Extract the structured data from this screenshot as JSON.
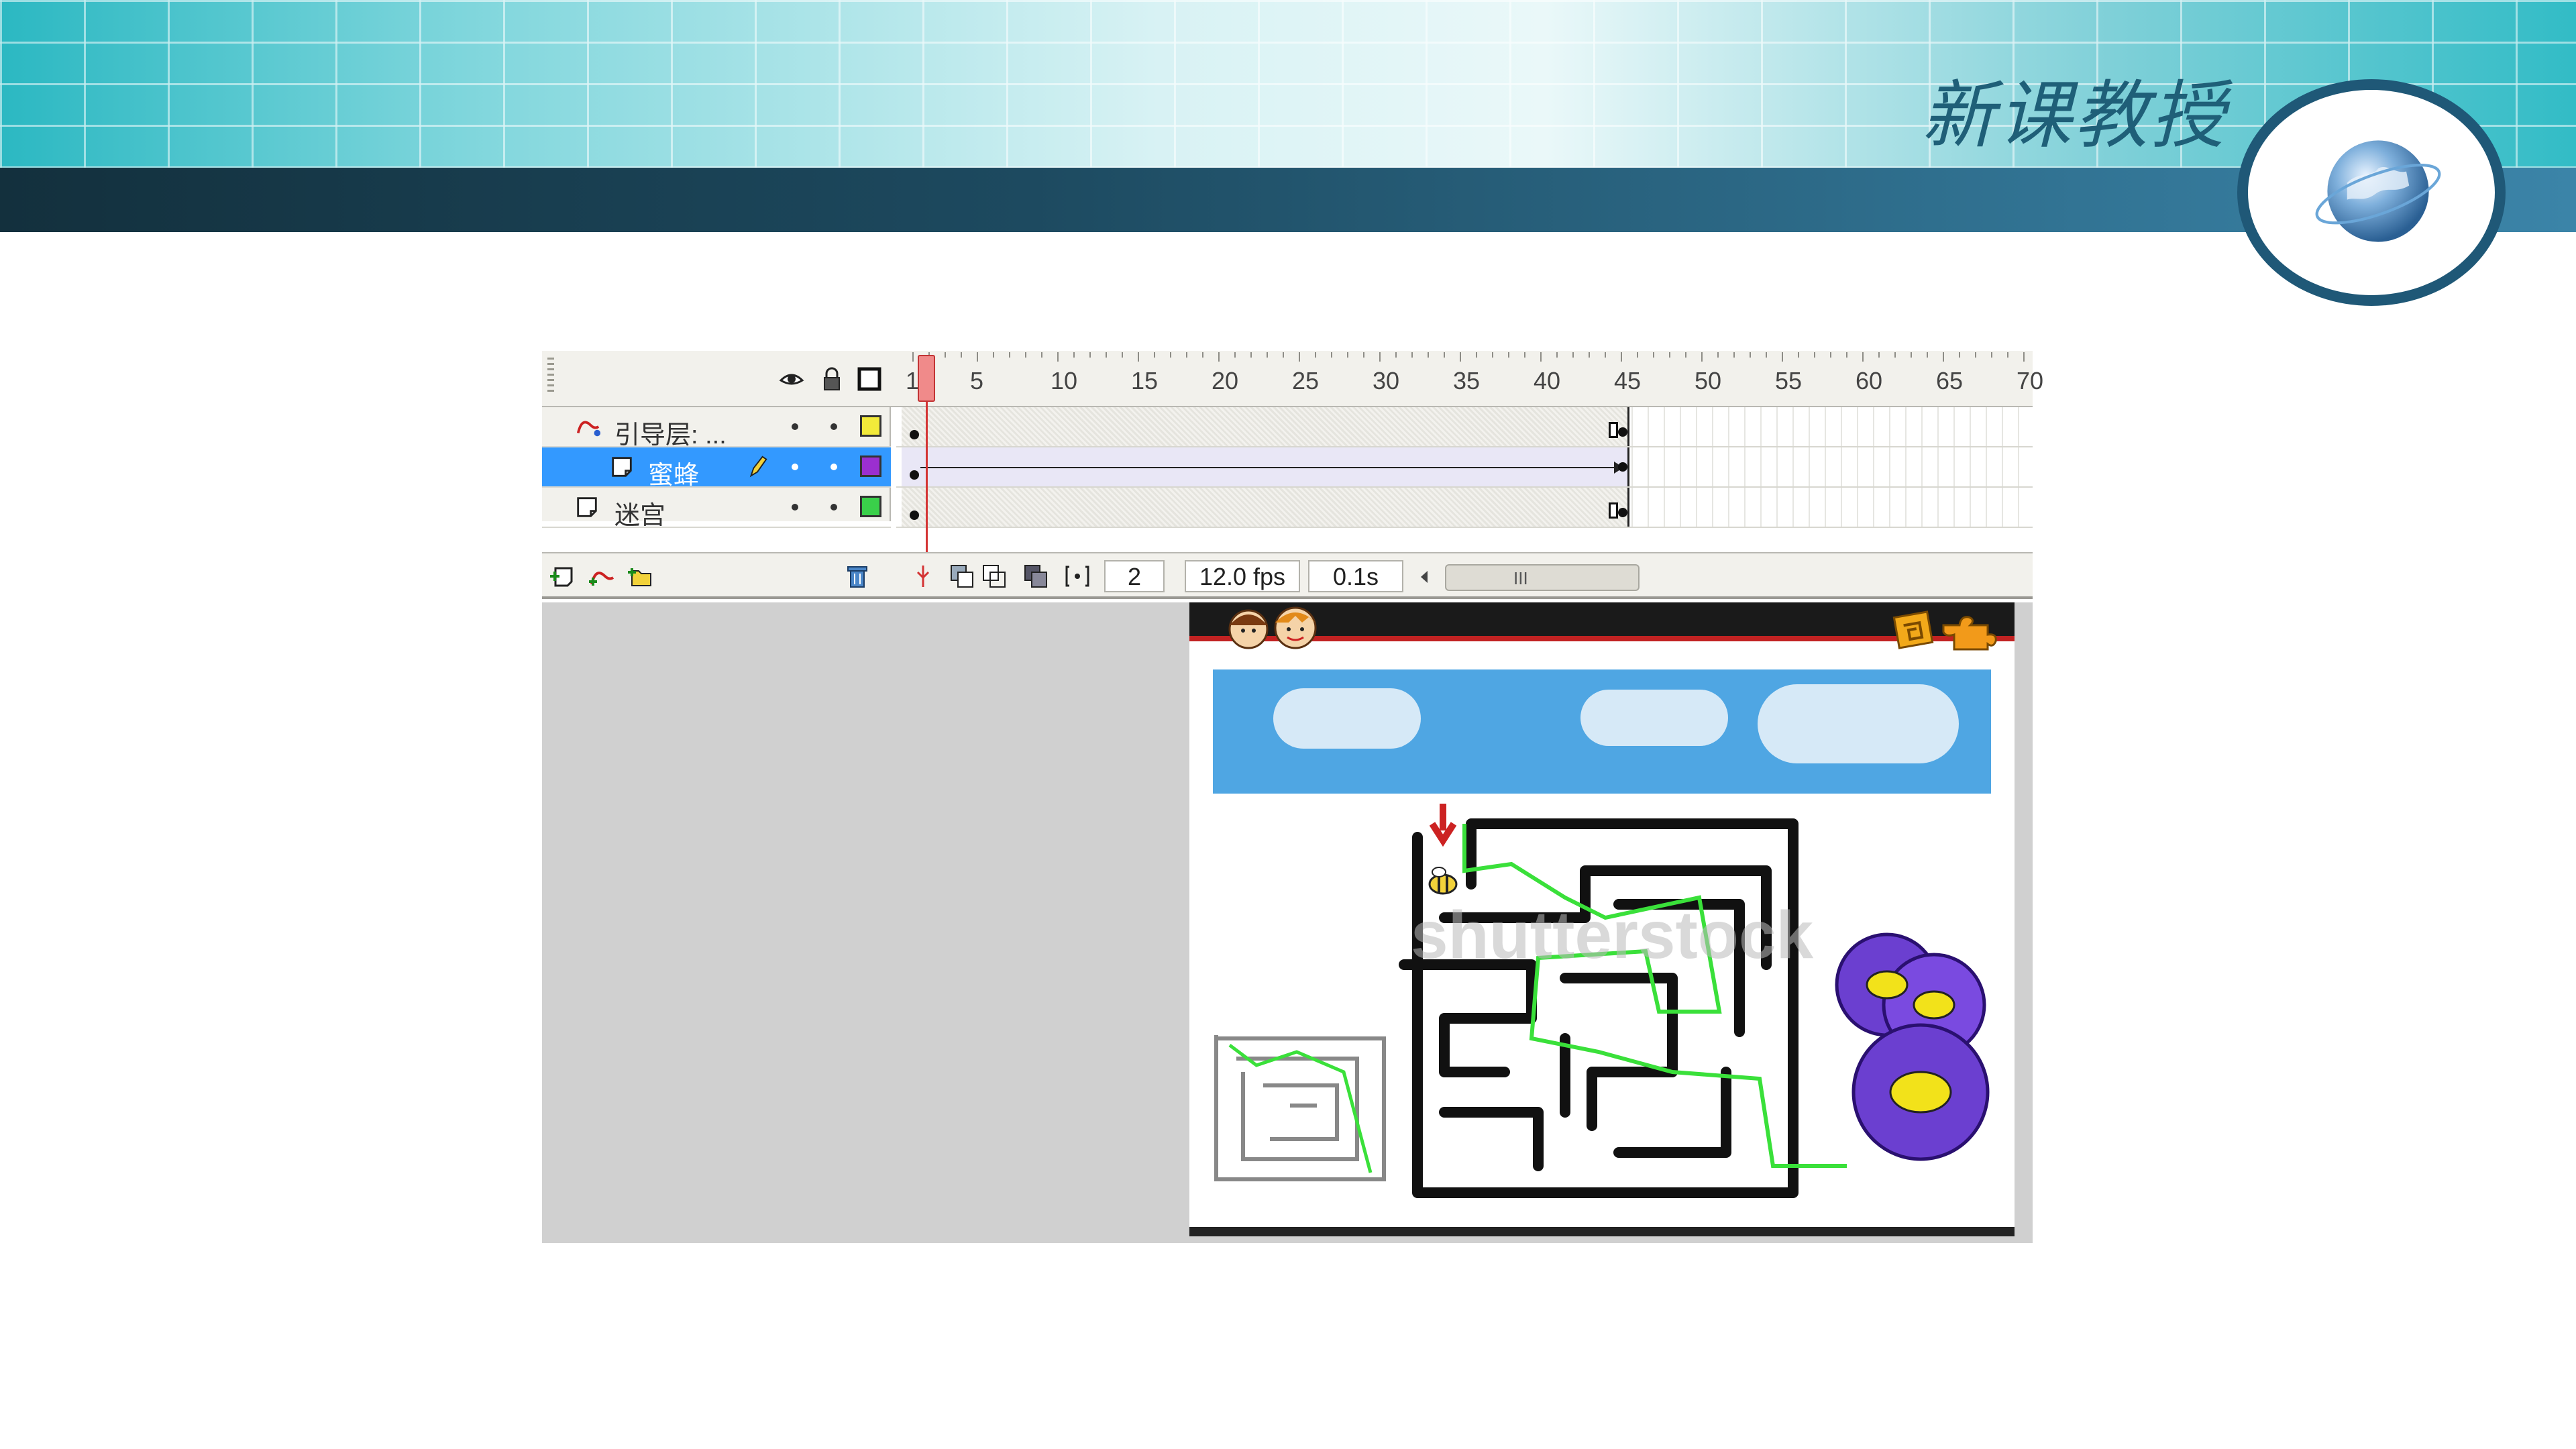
{
  "slide": {
    "title": "新课教授"
  },
  "timeline": {
    "ruler_numbers": [
      "1",
      "5",
      "10",
      "15",
      "20",
      "25",
      "30",
      "35",
      "40",
      "45",
      "50",
      "55",
      "60",
      "65",
      "70"
    ],
    "layers": [
      {
        "name": "引导层: ...",
        "color": "#f2ea3a",
        "selected": false,
        "type": "guide"
      },
      {
        "name": "蜜蜂",
        "color": "#9b2fd0",
        "selected": true,
        "type": "normal"
      },
      {
        "name": "迷宫",
        "color": "#3ad04a",
        "selected": false,
        "type": "normal"
      }
    ],
    "footer": {
      "current_frame": "2",
      "frame_rate": "12.0 fps",
      "elapsed_time": "0.1s"
    }
  },
  "stage": {
    "watermark": "shutterstock"
  },
  "colors": {
    "selection": "#3399ff",
    "playhead": "#d43434",
    "sky": "#4fa6e3",
    "maze_path": "#3ae03a",
    "header_teal": "#2bb8c2",
    "header_dark": "#1d4a60"
  },
  "icons": {
    "eye": "eye-icon",
    "lock": "lock-icon",
    "outline": "outline-icon",
    "trash": "trash-icon",
    "globe": "globe-icon"
  }
}
